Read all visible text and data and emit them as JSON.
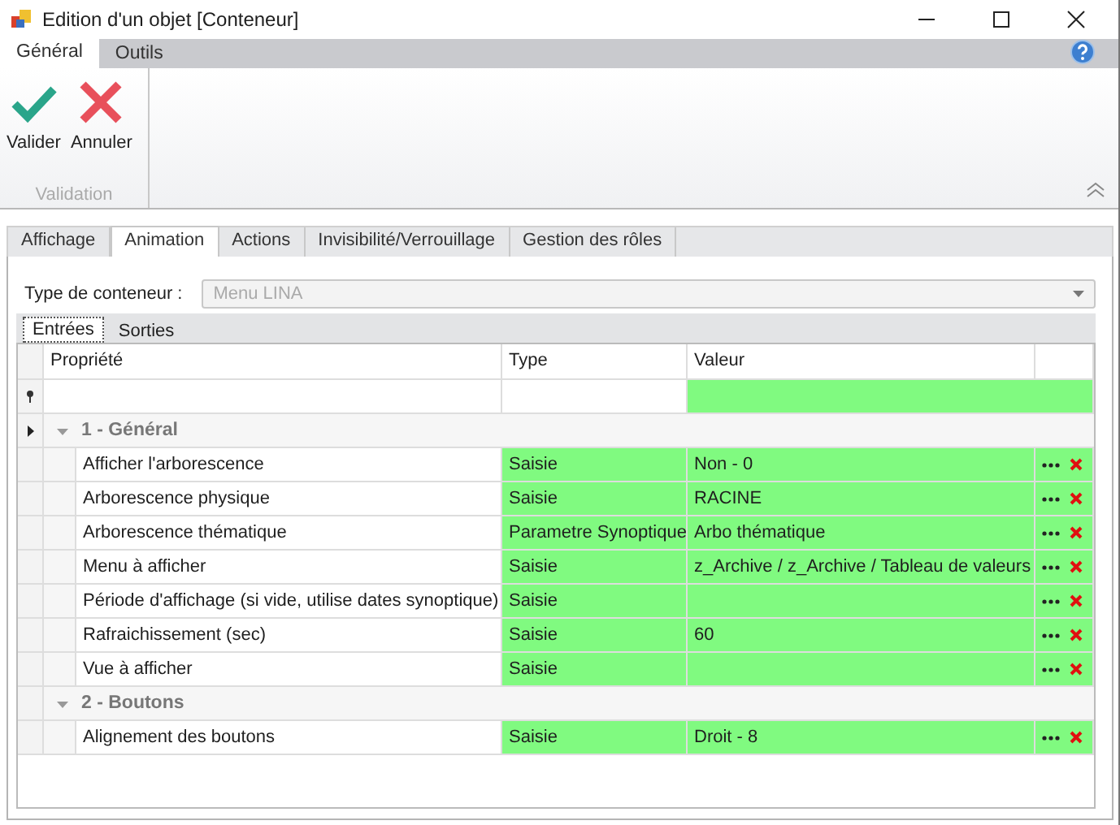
{
  "window": {
    "title": "Edition d'un objet [Conteneur]"
  },
  "ribbon": {
    "tabs": [
      {
        "label": "Général",
        "selected": true
      },
      {
        "label": "Outils",
        "selected": false
      }
    ],
    "groups": [
      {
        "label": "Validation",
        "buttons": [
          {
            "label": "Valider",
            "kind": "confirm"
          },
          {
            "label": "Annuler",
            "kind": "cancel"
          }
        ]
      }
    ]
  },
  "tabs": [
    {
      "label": "Affichage",
      "selected": false
    },
    {
      "label": "Animation",
      "selected": true
    },
    {
      "label": "Actions",
      "selected": false
    },
    {
      "label": "Invisibilité/Verrouillage",
      "selected": false
    },
    {
      "label": "Gestion des rôles",
      "selected": false
    }
  ],
  "container_type": {
    "label": "Type de conteneur :",
    "value": "Menu LINA",
    "disabled": true
  },
  "sub_tabs": [
    {
      "label": "Entrées",
      "selected": true
    },
    {
      "label": "Sorties",
      "selected": false
    }
  ],
  "grid": {
    "columns": [
      "Propriété",
      "Type",
      "Valeur"
    ],
    "groups": [
      {
        "title": "1 - Général",
        "expanded": true,
        "selected": true,
        "rows": [
          {
            "property": "Afficher l'arborescence",
            "type": "Saisie",
            "value": "Non - 0"
          },
          {
            "property": "Arborescence physique",
            "type": "Saisie",
            "value": "RACINE"
          },
          {
            "property": "Arborescence thématique",
            "type": "Parametre Synoptique",
            "value": "Arbo thématique"
          },
          {
            "property": "Menu à afficher",
            "type": "Saisie",
            "value": "z_Archive / z_Archive / Tableau de valeurs"
          },
          {
            "property": "Période d'affichage (si vide, utilise dates synoptique)",
            "type": "Saisie"
          },
          {
            "property": "Rafraichissement (sec)",
            "type": "Saisie",
            "value": "60"
          },
          {
            "property": "Vue à afficher",
            "type": "Saisie"
          }
        ]
      },
      {
        "title": "2 - Boutons",
        "expanded": true,
        "selected": false,
        "rows": [
          {
            "property": "Alignement des boutons",
            "type": "Saisie",
            "value": "Droit - 8"
          }
        ]
      }
    ]
  }
}
